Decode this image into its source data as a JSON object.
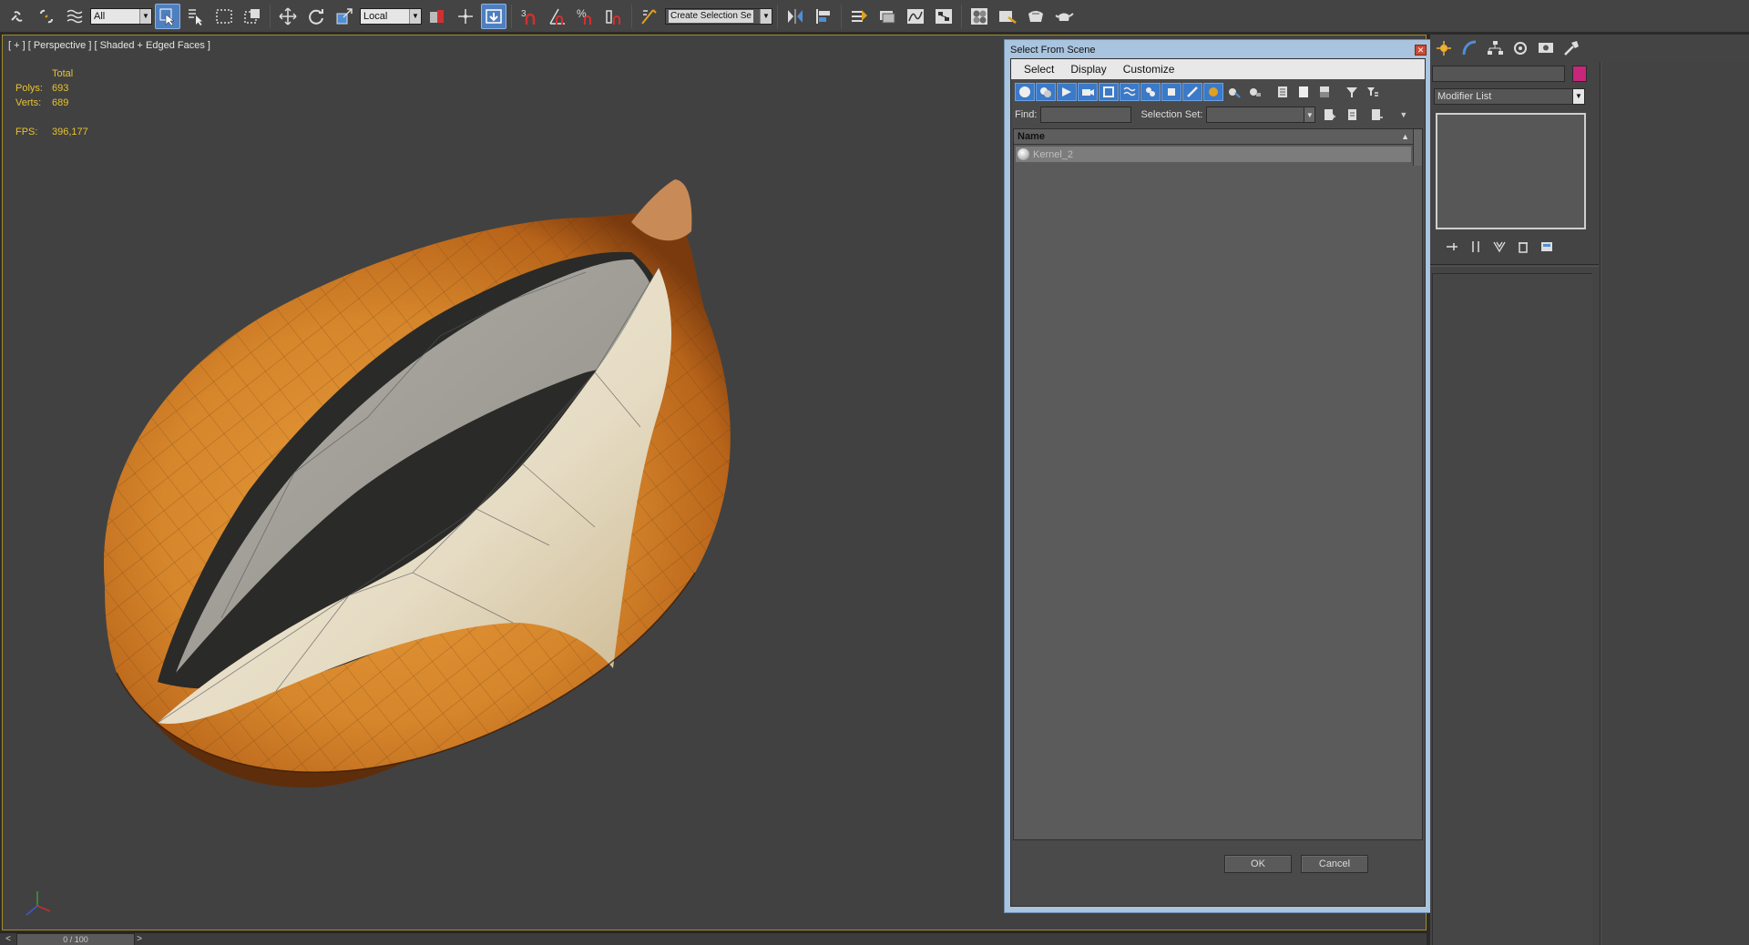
{
  "toolbar": {
    "selection_filter": "All",
    "ref_coord_system": "Local",
    "snap_3d_label": "3",
    "angle_snap_label": "",
    "percent_snap_label": "%",
    "named_selection_placeholder": "Create Selection Se"
  },
  "viewport": {
    "label": "[ + ] [ Perspective ] [ Shaded + Edged Faces ]",
    "stats": {
      "header": "Total",
      "polys_label": "Polys:",
      "polys_value": "693",
      "verts_label": "Verts:",
      "verts_value": "689",
      "fps_label": "FPS:",
      "fps_value": "396,177"
    },
    "stats_color": "#e8c230",
    "border_color": "#a38b2a"
  },
  "dialog": {
    "title": "Select From Scene",
    "close_glyph": "✕",
    "menu": [
      "Select",
      "Display",
      "Customize"
    ],
    "find_label": "Find:",
    "selection_set_label": "Selection Set:",
    "column_name": "Name",
    "column_sort_glyph": "▲",
    "objects": [
      {
        "name": "Kernel_2",
        "icon": "sphere-icon",
        "selected": true
      }
    ],
    "ok_label": "OK",
    "cancel_label": "Cancel"
  },
  "command_panel": {
    "modifier_list_label": "Modifier List",
    "object_color": "#c8267a",
    "tabs": [
      "create-icon",
      "modify-icon",
      "hierarchy-icon",
      "motion-icon",
      "display-icon",
      "utilities-icon"
    ]
  },
  "timeline": {
    "frame_display": "0 / 100",
    "prev_glyph": "<",
    "next_glyph": ">"
  }
}
